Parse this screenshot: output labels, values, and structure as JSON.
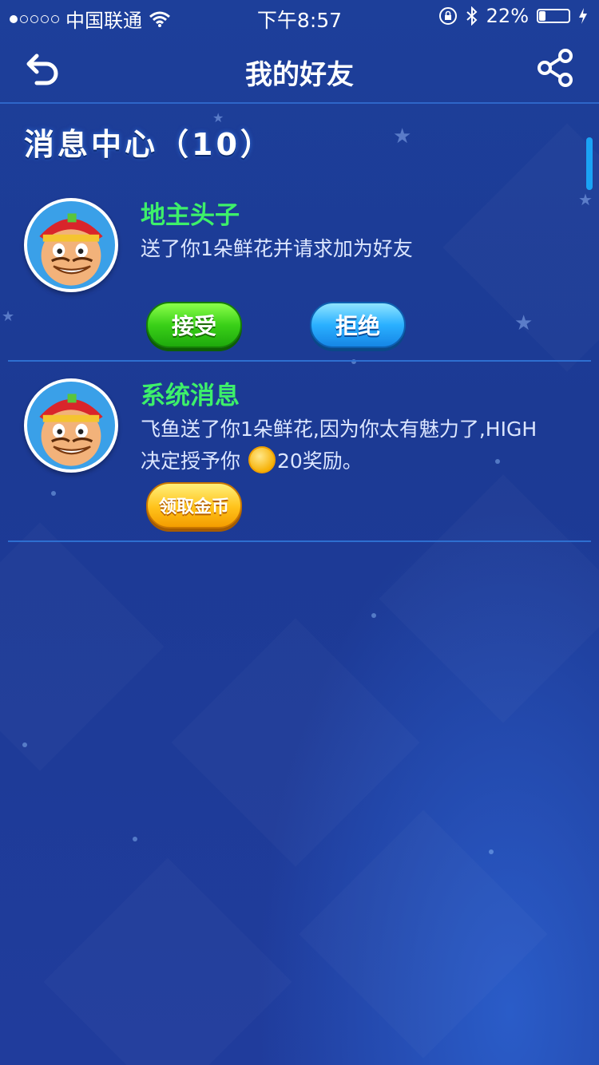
{
  "status_bar": {
    "carrier": "中国联通",
    "time": "下午8:57",
    "battery_percent": "22%",
    "battery_level": 0.22,
    "icons": [
      "signal-dots-icon",
      "wifi-icon",
      "rotation-lock-icon",
      "bluetooth-icon",
      "battery-icon",
      "charging-bolt-icon"
    ]
  },
  "nav": {
    "title": "我的好友",
    "back_icon": "back-arrow-icon",
    "share_icon": "share-icon"
  },
  "section": {
    "title": "消息中心（10）"
  },
  "messages": [
    {
      "sender": "地主头子",
      "text": "送了你1朵鲜花并请求加为好友",
      "avatar_icon": "cartoon-landlord-avatar",
      "accept_label": "接受",
      "reject_label": "拒绝"
    },
    {
      "sender": "系统消息",
      "text_line1": "飞鱼送了你1朵鲜花,因为你太有魅力了,HIGH",
      "text_line2_prefix": "决定授予你",
      "coin_icon": "gold-coin-icon",
      "text_line2_suffix": "20奖励。",
      "avatar_icon": "cartoon-landlord-avatar",
      "claim_label": "领取金币"
    }
  ],
  "colors": {
    "background": "#1d3f9a",
    "name_green": "#3df06a",
    "divider": "#2e6fd0",
    "accept_green": "#3ad018",
    "reject_blue": "#2ab0ff",
    "claim_gold": "#ffc21a"
  }
}
